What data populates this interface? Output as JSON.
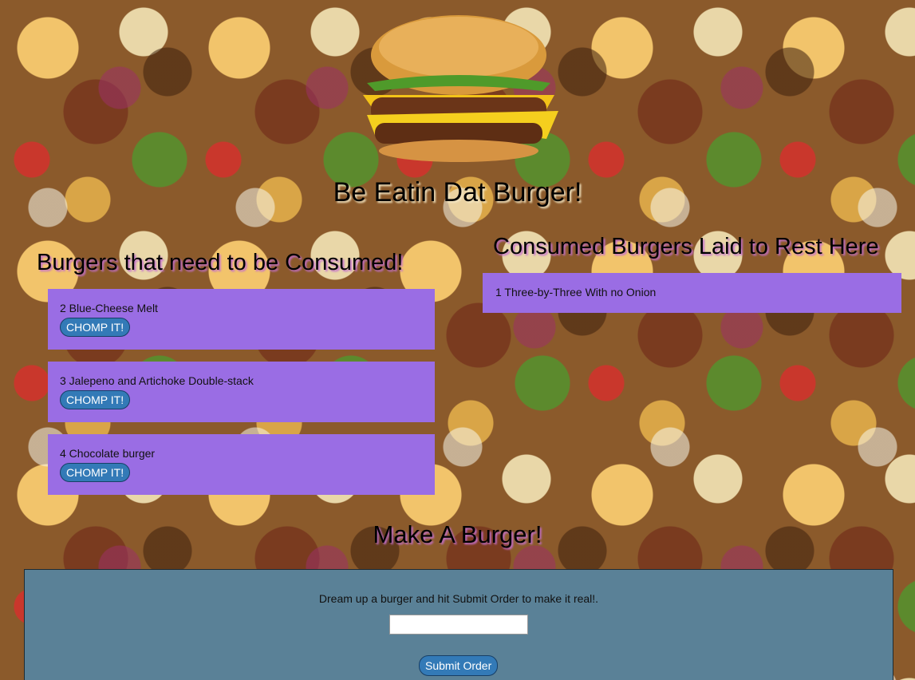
{
  "page": {
    "title": "Be Eatin Dat Burger!"
  },
  "uneaten": {
    "heading": "Burgers that need to be Consumed!",
    "items": [
      {
        "label": "2 Blue-Cheese Melt",
        "button": "CHOMP IT!"
      },
      {
        "label": "3 Jalepeno and Artichoke Double-stack",
        "button": "CHOMP IT!"
      },
      {
        "label": "4 Chocolate burger",
        "button": "CHOMP IT!"
      }
    ]
  },
  "eaten": {
    "heading": "Consumed Burgers Laid to Rest Here",
    "items": [
      {
        "label": "1 Three-by-Three With no Onion"
      }
    ]
  },
  "form": {
    "heading": "Make A Burger!",
    "instructions": "Dream up a burger and hit Submit Order to make it real!.",
    "input_value": "",
    "input_placeholder": "",
    "submit_label": "Submit Order"
  },
  "colors": {
    "card_bg": "#9a6de4",
    "button_bg": "#337ab7",
    "form_bg": "#5a8197"
  },
  "icons": {
    "background": "burger-collage-background",
    "hero": "burger-icon"
  }
}
